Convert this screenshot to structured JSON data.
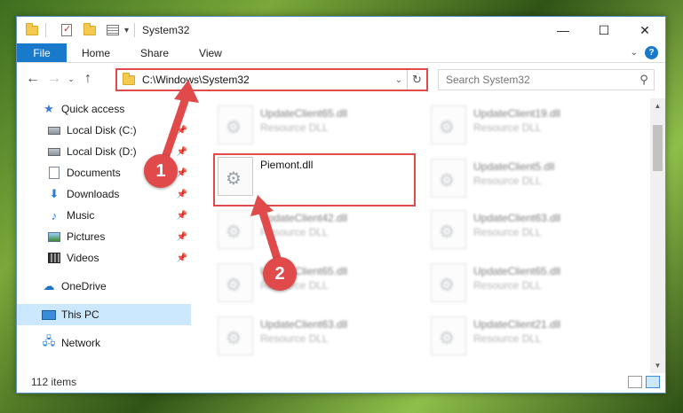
{
  "window": {
    "title": "System32",
    "controls": {
      "minimize": "—",
      "maximize": "☐",
      "close": "✕"
    }
  },
  "ribbon": {
    "tabs": [
      "File",
      "Home",
      "Share",
      "View"
    ],
    "expand_icon": "⌄",
    "help": "?"
  },
  "address": {
    "path": "C:\\Windows\\System32",
    "dropdown": "⌄",
    "refresh": "↻"
  },
  "search": {
    "placeholder": "Search System32",
    "icon": "⚲"
  },
  "nav": {
    "back": "←",
    "forward": "→",
    "recent": "⌄",
    "up": "↑"
  },
  "sidebar": {
    "items": [
      {
        "label": "Quick access",
        "icon": "star-icon",
        "pinned": false
      },
      {
        "label": "Local Disk (C:)",
        "icon": "disk-icon",
        "pinned": true
      },
      {
        "label": "Local Disk (D:)",
        "icon": "disk-icon",
        "pinned": true
      },
      {
        "label": "Documents",
        "icon": "documents-icon",
        "pinned": true
      },
      {
        "label": "Downloads",
        "icon": "download-icon",
        "pinned": true
      },
      {
        "label": "Music",
        "icon": "music-icon",
        "pinned": true
      },
      {
        "label": "Pictures",
        "icon": "pictures-icon",
        "pinned": true
      },
      {
        "label": "Videos",
        "icon": "video-icon",
        "pinned": true
      },
      {
        "label": "OneDrive",
        "icon": "cloud-icon",
        "pinned": false
      },
      {
        "label": "This PC",
        "icon": "computer-icon",
        "pinned": false,
        "selected": true
      },
      {
        "label": "Network",
        "icon": "network-icon",
        "pinned": false
      }
    ]
  },
  "files": [
    {
      "name": "UpdateClient65.dll",
      "type": "Resource DLL",
      "blurred": true
    },
    {
      "name": "UpdateClient19.dll",
      "type": "Resource DLL",
      "blurred": true
    },
    {
      "name": "Piemont.dll",
      "type": "",
      "blurred": false,
      "highlighted": true
    },
    {
      "name": "UpdateClient5.dll",
      "type": "Resource DLL",
      "blurred": true
    },
    {
      "name": "UpdateClient42.dll",
      "type": "Resource DLL",
      "blurred": true
    },
    {
      "name": "UpdateClient63.dll",
      "type": "Resource DLL",
      "blurred": true
    },
    {
      "name": "UpdateClient65.dll",
      "type": "Resource DLL",
      "blurred": true
    },
    {
      "name": "UpdateClient65.dll",
      "type": "Resource DLL",
      "blurred": true
    },
    {
      "name": "UpdateClient63.dll",
      "type": "Resource DLL",
      "blurred": true
    },
    {
      "name": "UpdateClient21.dll",
      "type": "Resource DLL",
      "blurred": true
    }
  ],
  "status": {
    "item_count": "112 items"
  },
  "annotations": {
    "badge1": "1",
    "badge2": "2",
    "color": "#e04a4a"
  }
}
